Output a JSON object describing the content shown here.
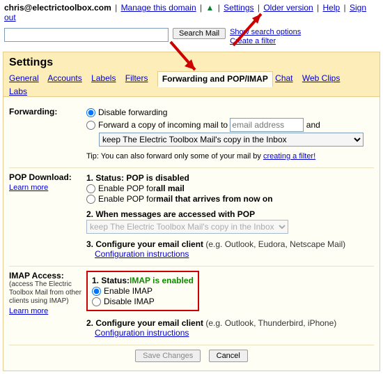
{
  "header": {
    "email": "chris@electrictoolbox.com",
    "links": {
      "manage": "Manage this domain",
      "settings": "Settings",
      "older": "Older version",
      "help": "Help",
      "signout": "Sign out"
    }
  },
  "search": {
    "button": "Search Mail",
    "opt": "Show search options",
    "filter": "Create a filter"
  },
  "panel_title": "Settings",
  "tabs": {
    "general": "General",
    "accounts": "Accounts",
    "labels": "Labels",
    "filters": "Filters",
    "fwd": "Forwarding and POP/IMAP",
    "chat": "Chat",
    "clips": "Web Clips",
    "labs": "Labs"
  },
  "forwarding": {
    "label": "Forwarding:",
    "disable": "Disable forwarding",
    "fwd_copy": "Forward a copy of incoming mail to",
    "email_ph": "email address",
    "and": "and",
    "keep_sel": "keep The Electric Toolbox Mail's copy in the Inbox",
    "tip_pre": "Tip: You can also forward only some of your mail by ",
    "tip_link": "creating a filter!"
  },
  "pop": {
    "label": "POP Download:",
    "learn": "Learn more",
    "status_h": "1. Status: ",
    "status": "POP is disabled",
    "opt_all": "Enable POP for ",
    "opt_all_b": "all mail",
    "opt_now": "Enable POP for ",
    "opt_now_b": "mail that arrives from now on",
    "when_h": "2. When messages are accessed with POP",
    "when_sel": "keep The Electric Toolbox Mail's copy in the Inbox",
    "conf_h": "3. Configure your email client",
    "conf_eg": " (e.g. Outlook, Eudora, Netscape Mail)",
    "conf_link": "Configuration instructions"
  },
  "imap": {
    "label": "IMAP Access:",
    "sub": "(access The Electric Toolbox Mail from other clients using IMAP)",
    "learn": "Learn more",
    "status_h": "1. Status: ",
    "status": "IMAP is enabled",
    "enable": "Enable IMAP",
    "disable": "Disable IMAP",
    "conf_h": "2. Configure your email client",
    "conf_eg": " (e.g. Outlook, Thunderbird, iPhone)",
    "conf_link": "Configuration instructions"
  },
  "footer": {
    "save": "Save Changes",
    "cancel": "Cancel"
  }
}
